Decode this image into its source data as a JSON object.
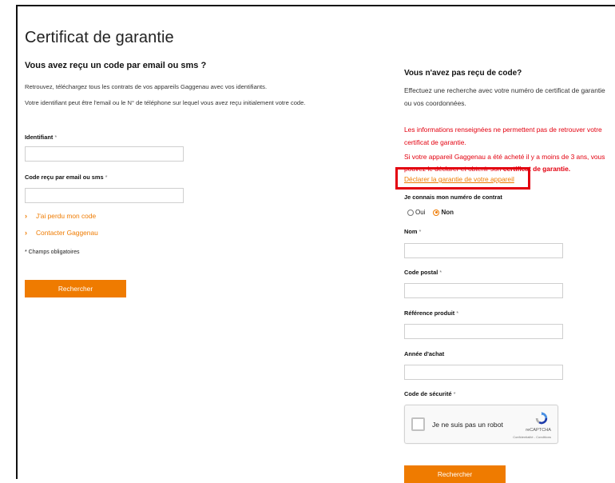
{
  "page": {
    "title": "Certificat de garantie"
  },
  "left": {
    "heading": "Vous avez reçu un code par email ou sms ?",
    "intro1": "Retrouvez, téléchargez tous les contrats de vos appareils Gaggenau avec vos identifiants.",
    "intro2": "Votre identifiant peut être l'email ou le N° de téléphone sur lequel vous avez reçu initialement votre code.",
    "identifiant_label": "Identifiant",
    "code_label": "Code reçu par email ou sms",
    "required_mark": "*",
    "lost_code_link": "J'ai perdu mon code",
    "contact_link": "Contacter Gaggenau",
    "chevron": "›",
    "required_note": "* Champs obligatoires",
    "search_button": "Rechercher"
  },
  "right": {
    "heading": "Vous n'avez pas reçu de code?",
    "intro1": "Effectuez une recherche avec votre numéro de certificat de garantie",
    "intro2": "ou vos coordonnées.",
    "error1_line1": "Les informations renseignées ne permettent pas de retrouver votre",
    "error1_line2": "certificat de garantie.",
    "error2_line1": "Si votre appareil Gaggenau a été acheté il y a moins de 3 ans, vous",
    "error2_line2_a": "pouvez le déclarer et obtenir son",
    "error2_line2_b": "certificat de garantie.",
    "declare_link": "Déclarer la garantie de votre appareil",
    "contract_question": "Je connais mon numéro de contrat",
    "radio_yes": "Oui",
    "radio_no": "Non",
    "radio_selected": "Non",
    "nom_label": "Nom",
    "cp_label": "Code postal",
    "ref_label": "Référence produit",
    "annee_label": "Année d'achat",
    "secu_label": "Code de sécurité",
    "required_mark": "*",
    "captcha_text": "Je ne suis pas un robot",
    "captcha_brand": "reCAPTCHA",
    "captcha_terms": "Confidentialité - Conditions",
    "search_button": "Rechercher"
  },
  "colors": {
    "accent": "#ef7b00",
    "error": "#e3000f",
    "highlight_border": "#e3000f"
  }
}
